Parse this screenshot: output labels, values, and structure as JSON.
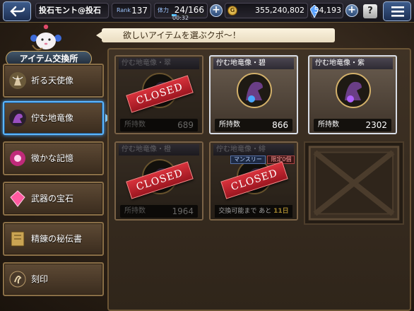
{
  "topbar": {
    "player_name": "投石モント@投石",
    "rank_label": "Rank",
    "rank_value": "137",
    "stamina_label": "体力",
    "stamina_value": "24/166",
    "stamina_fraction": 0.145,
    "stamina_timer": "00:32",
    "gil_label": "G",
    "gil_value": "355,240,802",
    "crystal_value": "54,193",
    "help_label": "?",
    "plus_label": "+"
  },
  "header": {
    "banner_text": "欲しいアイテムを選ぶクポ～！",
    "section_title": "アイテム交換所"
  },
  "sidebar": {
    "items": [
      {
        "label": "祈る天使像",
        "active": false
      },
      {
        "label": "佇む地竜像",
        "active": true
      },
      {
        "label": "微かな記憶",
        "active": false
      },
      {
        "label": "武器の宝石",
        "active": false
      },
      {
        "label": "精錬の秘伝書",
        "active": false
      },
      {
        "label": "刻印",
        "active": false
      }
    ]
  },
  "cards": [
    {
      "title": "佇む地竜像・翠",
      "count_label": "所持数",
      "count": "689",
      "closed": true,
      "stamp": "CLOSED"
    },
    {
      "title": "佇む地竜像・碧",
      "count_label": "所持数",
      "count": "866",
      "closed": false
    },
    {
      "title": "佇む地竜像・紫",
      "count_label": "所持数",
      "count": "2302",
      "closed": false
    },
    {
      "title": "佇む地竜像・橙",
      "count_label": "所持数",
      "count": "1964",
      "closed": true,
      "stamp": "CLOSED"
    },
    {
      "title": "佇む地竜像・緋",
      "closed": true,
      "stamp": "CLOSED",
      "tag_monthly": "マンスリー",
      "tag_limit": "限定0個",
      "exchange_prefix": "交換可能まで あと",
      "exchange_days": "11日"
    }
  ],
  "colors": {
    "gem_green": "#3fbf6a",
    "gem_blue": "#4aa8ff",
    "gem_purple": "#b062ff",
    "gem_orange": "#ff9a3a",
    "gem_red": "#ff4a4a"
  }
}
